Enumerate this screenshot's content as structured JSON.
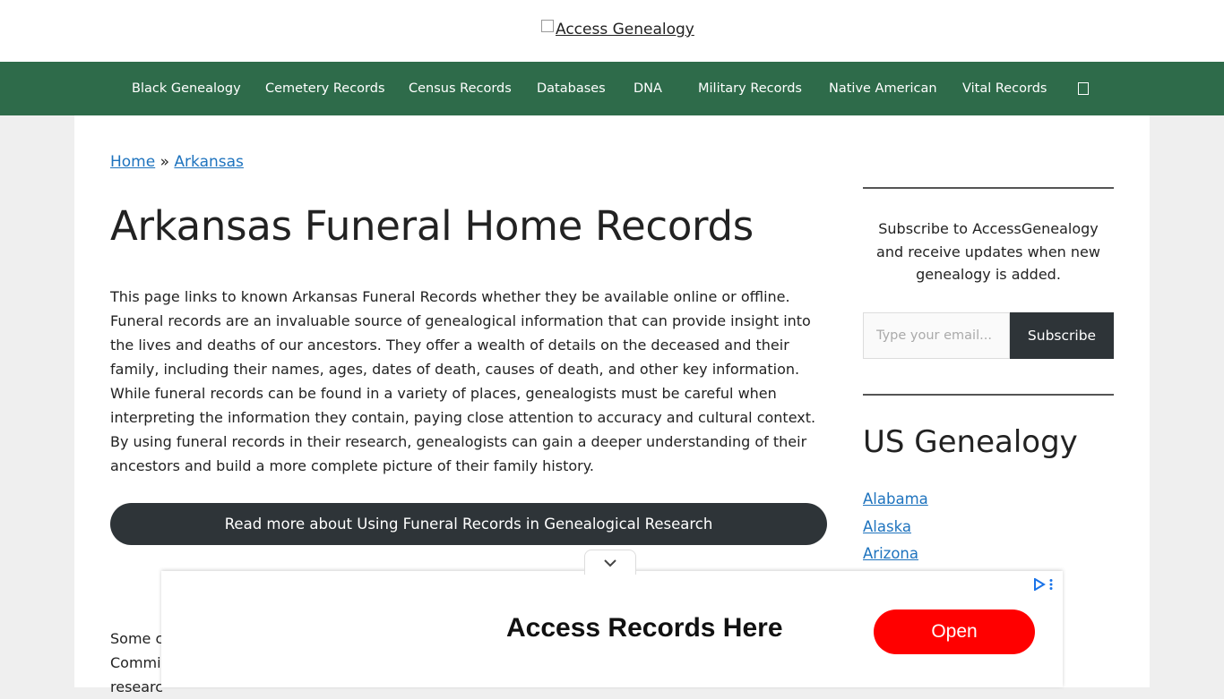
{
  "header": {
    "logo_alt": "Access Genealogy"
  },
  "nav": {
    "items": [
      {
        "label": "Black Genealogy"
      },
      {
        "label": "Cemetery Records"
      },
      {
        "label": "Census Records"
      },
      {
        "label": "Databases"
      },
      {
        "label": "DNA"
      },
      {
        "label": "Military Records"
      },
      {
        "label": "Native American"
      },
      {
        "label": "Vital Records"
      }
    ],
    "search_icon": "search-icon"
  },
  "breadcrumb": {
    "home": "Home",
    "separator": "»",
    "current": "Arkansas"
  },
  "article": {
    "title": "Arkansas Funeral Home Records",
    "intro": "This page links to known Arkansas Funeral Records whether they be available online or offline. Funeral records are an invaluable source of genealogical information that can provide insight into the lives and deaths of our ancestors. They offer a wealth of details on the deceased and their family, including their names, ages, dates of death, causes of death, and other key information. While funeral records can be found in a variety of places, genealogists must be careful when interpreting the information they contain, paying close attention to accuracy and cultural context. By using funeral records in their research, genealogists can gain a deeper understanding of their ancestors and build a more complete picture of their family history.",
    "read_more": "Read more about Using Funeral Records in Genealogical Research",
    "partial_line_1": "Some c",
    "partial_line_2": "Commi",
    "partial_line_3": "researc"
  },
  "sidebar": {
    "subscribe_text": "Subscribe to AccessGenealogy and receive updates when new genealogy is added.",
    "email_placeholder": "Type your email...",
    "subscribe_button": "Subscribe",
    "us_title": "US Genealogy",
    "states": [
      "Alabama",
      "Alaska",
      "Arizona"
    ]
  },
  "ad": {
    "headline": "Access Records Here",
    "cta": "Open",
    "collapse_icon": "chevron-down-icon",
    "adchoices_icon": "ad-choices-icon",
    "cta_color": "#ff0000"
  },
  "colors": {
    "nav_bg": "#2e6b4a",
    "button_dark": "#2e3438",
    "link": "#1e73be"
  }
}
